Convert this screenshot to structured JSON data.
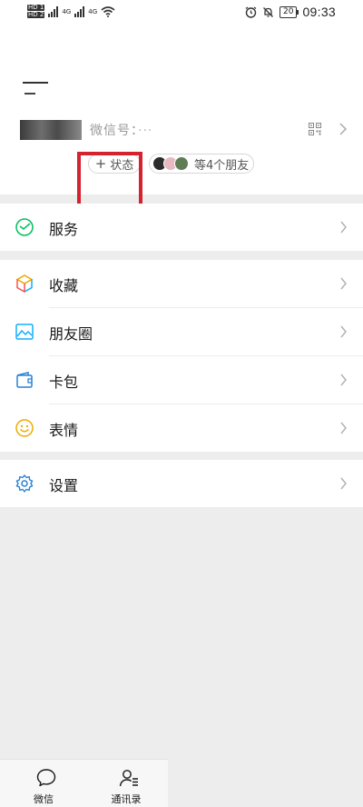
{
  "status_bar": {
    "hd1": "HD 1",
    "hd2": "HD 2",
    "net1": "4G",
    "net2": "4G",
    "battery": "20",
    "time": "09:33"
  },
  "profile": {
    "wechat_id_label": "微信号：",
    "wechat_id_value": "···",
    "status_button_label": "状态",
    "friends_chip_label": "等4个朋友"
  },
  "menu": {
    "services": {
      "label": "服务",
      "icon": "wechat-pay-icon"
    },
    "favorites": {
      "label": "收藏",
      "icon": "favorites-cube-icon"
    },
    "moments": {
      "label": "朋友圈",
      "icon": "moments-image-icon"
    },
    "cards": {
      "label": "卡包",
      "icon": "card-wallet-icon"
    },
    "stickers": {
      "label": "表情",
      "icon": "smiley-icon"
    },
    "settings": {
      "label": "设置",
      "icon": "gear-icon"
    }
  },
  "tabbar": {
    "chats": {
      "label": "微信",
      "icon": "chat-bubble-icon"
    },
    "contacts": {
      "label": "通讯录",
      "icon": "contacts-icon"
    }
  },
  "colors": {
    "accent_green": "#07c160",
    "highlight_red": "#d4222f",
    "background": "#ededed"
  }
}
